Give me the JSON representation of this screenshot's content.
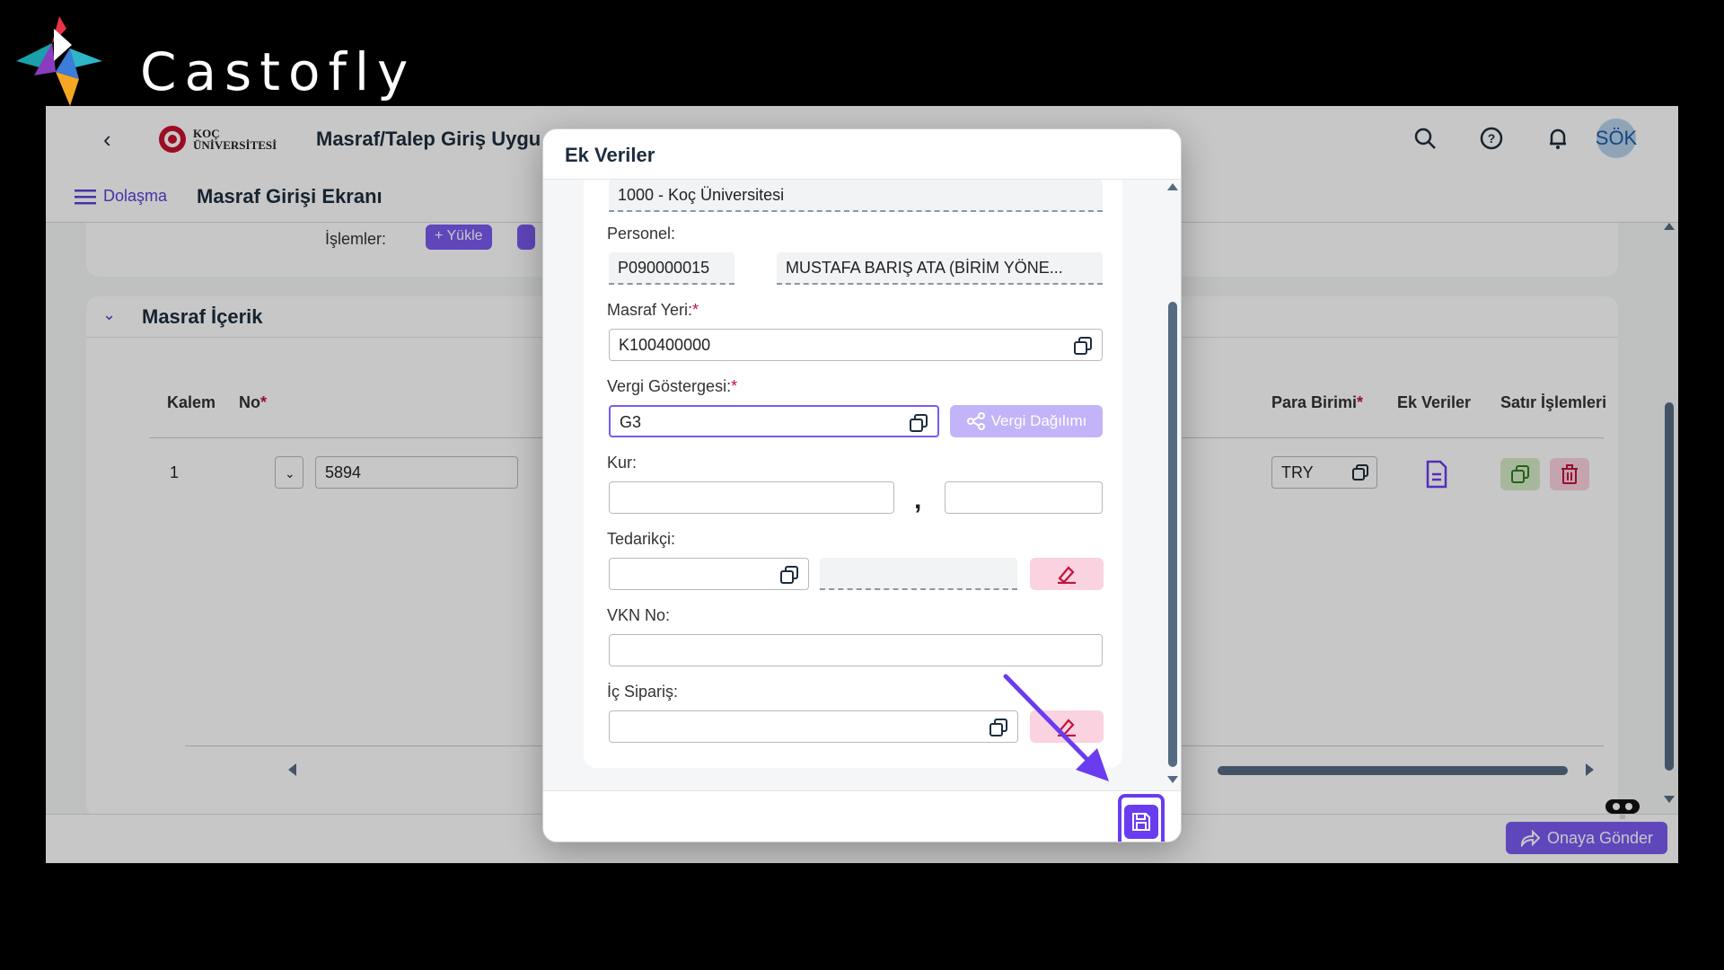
{
  "brand": {
    "name": "Castofly"
  },
  "shellbar": {
    "logo_line1": "KOÇ",
    "logo_line2": "ÜNİVERSİTESİ",
    "title": "Masraf/Talep Giriş Uygu",
    "avatar": "SÖK"
  },
  "subbar": {
    "nav_label": "Dolaşma",
    "page_title": "Masraf Girişi Ekranı"
  },
  "card1": {
    "label": "İşlemler:",
    "btn_upload": "Yükle"
  },
  "section": {
    "title": "Masraf İçerik",
    "columns": {
      "kalem": "Kalem",
      "no": "No",
      "para_birimi": "Para Birimi",
      "ek_veriler": "Ek Veriler",
      "satir_islemleri": "Satır İşlemleri"
    },
    "row": {
      "kalem": "1",
      "no_value": "5894",
      "currency": "TRY"
    }
  },
  "footer": {
    "send_label": "Onaya Gönder"
  },
  "dialog": {
    "title": "Ek Veriler",
    "company_value": "1000 - Koç Üniversitesi",
    "personel_label": "Personel:",
    "personel_id": "P090000015",
    "personel_name": "MUSTAFA BARIŞ  ATA (BİRİM YÖNE...",
    "masraf_yeri_label": "Masraf Yeri:",
    "masraf_yeri_value": "K100400000",
    "vergi_label": "Vergi Göstergesi:",
    "vergi_value": "G3",
    "vergi_btn": "Vergi Dağılımı",
    "kur_label": "Kur:",
    "kur_sep": ",",
    "tedarikci_label": "Tedarikçi:",
    "vkn_label": "VKN No:",
    "ic_siparis_label": "İç Sipariş:"
  },
  "colors": {
    "accent": "#6a3cf0",
    "pink": "#fbd2e0",
    "danger": "#c0143c"
  }
}
